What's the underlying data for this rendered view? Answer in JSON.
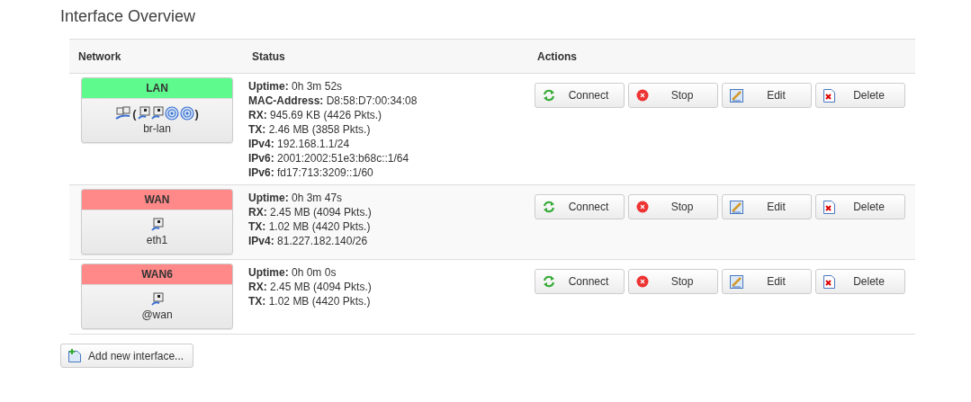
{
  "title": "Interface Overview",
  "table": {
    "columns": [
      "Network",
      "Status",
      "Actions"
    ],
    "rows": [
      {
        "name": "LAN",
        "color": "#5ffa8e",
        "device": "br-lan",
        "icons": [
          {
            "kind": "bridge"
          },
          {
            "kind": "text",
            "text": "("
          },
          {
            "kind": "ethernet"
          },
          {
            "kind": "ethernet"
          },
          {
            "kind": "wifi"
          },
          {
            "kind": "wifi"
          },
          {
            "kind": "text",
            "text": ")"
          }
        ],
        "status": [
          {
            "label": "Uptime:",
            "value": "0h 3m 52s"
          },
          {
            "label": "MAC-Address:",
            "value": "D8:58:D7:00:34:08"
          },
          {
            "label": "RX:",
            "value": "945.69 KB (4426 Pkts.)"
          },
          {
            "label": "TX:",
            "value": "2.46 MB (3858 Pkts.)"
          },
          {
            "label": "IPv4:",
            "value": "192.168.1.1/24"
          },
          {
            "label": "IPv6:",
            "value": "2001:2002:51e3:b68c::1/64"
          },
          {
            "label": "IPv6:",
            "value": "fd17:713:3209::1/60"
          }
        ],
        "actions": [
          {
            "kind": "connect",
            "label": "Connect"
          },
          {
            "kind": "stop",
            "label": "Stop"
          },
          {
            "kind": "edit",
            "label": "Edit"
          },
          {
            "kind": "delete",
            "label": "Delete"
          }
        ]
      },
      {
        "name": "WAN",
        "color": "#ff8888",
        "device": "eth1",
        "icons": [
          {
            "kind": "ethernet"
          }
        ],
        "status": [
          {
            "label": "Uptime:",
            "value": "0h 3m 47s"
          },
          {
            "label": "RX:",
            "value": "2.45 MB (4094 Pkts.)"
          },
          {
            "label": "TX:",
            "value": "1.02 MB (4420 Pkts.)"
          },
          {
            "label": "IPv4:",
            "value": "81.227.182.140/26"
          }
        ],
        "actions": [
          {
            "kind": "connect",
            "label": "Connect"
          },
          {
            "kind": "stop",
            "label": "Stop"
          },
          {
            "kind": "edit",
            "label": "Edit"
          },
          {
            "kind": "delete",
            "label": "Delete"
          }
        ]
      },
      {
        "name": "WAN6",
        "color": "#ff8888",
        "device": "@wan",
        "icons": [
          {
            "kind": "ethernet"
          }
        ],
        "status": [
          {
            "label": "Uptime:",
            "value": "0h 0m 0s"
          },
          {
            "label": "RX:",
            "value": "2.45 MB (4094 Pkts.)"
          },
          {
            "label": "TX:",
            "value": "1.02 MB (4420 Pkts.)"
          }
        ],
        "actions": [
          {
            "kind": "connect",
            "label": "Connect"
          },
          {
            "kind": "stop",
            "label": "Stop"
          },
          {
            "kind": "edit",
            "label": "Edit"
          },
          {
            "kind": "delete",
            "label": "Delete"
          }
        ]
      }
    ]
  },
  "add_button": "Add new interface..."
}
